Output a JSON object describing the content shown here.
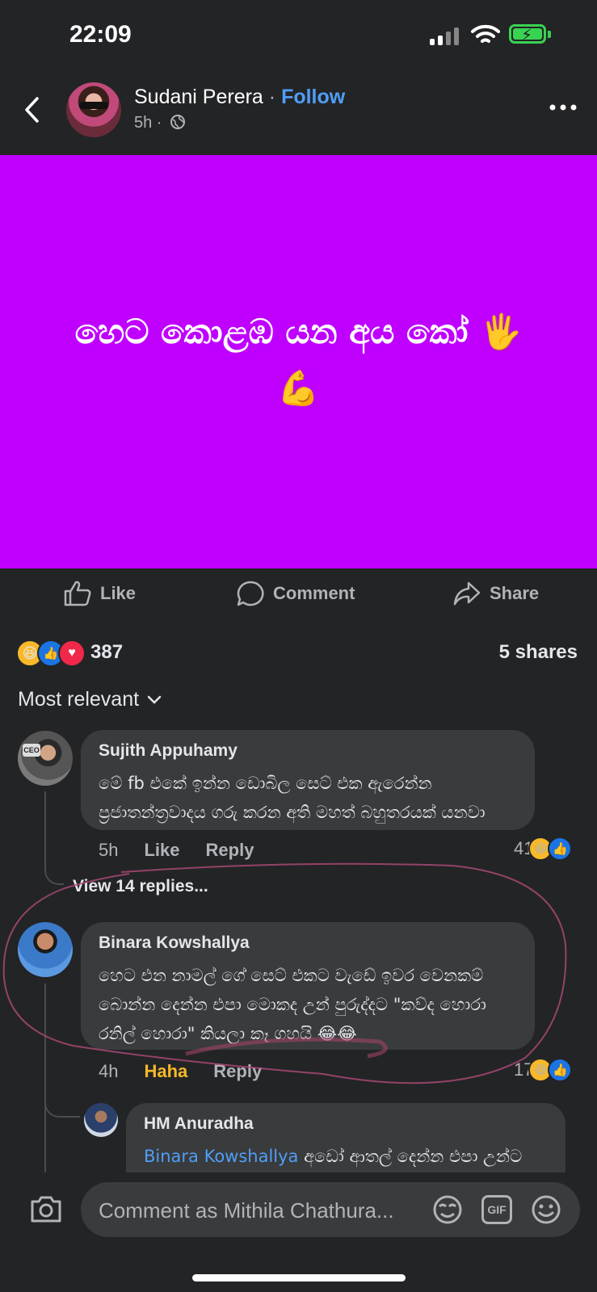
{
  "status": {
    "time": "22:09"
  },
  "header": {
    "author": "Sudani Perera",
    "separator": "·",
    "follow": "Follow",
    "post_time": "5h ·"
  },
  "post": {
    "background_color": "#c000ff",
    "text_line1": "හෙට කොළඹ යන අය කෝ 🖐️",
    "text_line2": "💪"
  },
  "actions": {
    "like": "Like",
    "comment": "Comment",
    "share": "Share"
  },
  "summary": {
    "reaction_count": "387",
    "shares": "5 shares"
  },
  "sort": {
    "label": "Most relevant"
  },
  "comments": [
    {
      "name": "Sujith Appuhamy",
      "text": "මේ fb එකේ ඉන්න ඩොබිල සෙට් එක ඇරෙන්න ප්‍රජාතන්ත්‍රවාදය ගරු කරන අති මහත් බහුතරයක් යනවා",
      "time": "5h",
      "like": "Like",
      "reply": "Reply",
      "reaction_count": "41",
      "view_replies": "View 14 replies..."
    },
    {
      "name": "Binara Kowshallya",
      "text": "හෙට එන නාමල් ගේ සෙට් එකට වැඩේ ඉවර වෙනකම් බොන්න දෙන්න එපා මොකද උන් පුරුද්දට \"කව්ද හොරා රනිල් හොරා\" කියලා කෑ ගහයි 😂😂",
      "time": "4h",
      "like": "Haha",
      "reply": "Reply",
      "reaction_count": "17"
    },
    {
      "name": "HM Anuradha",
      "mention": "Binara Kowshallya",
      "text": " අඩෝ ආතල් දෙන්න එපා උන්ට"
    }
  ],
  "composer": {
    "placeholder": "Comment as Mithila Chathura...",
    "gif": "GIF"
  },
  "colors": {
    "accent": "#4f9ef7",
    "haha": "#f7b928",
    "like": "#1b74e4",
    "love": "#f0284a"
  }
}
